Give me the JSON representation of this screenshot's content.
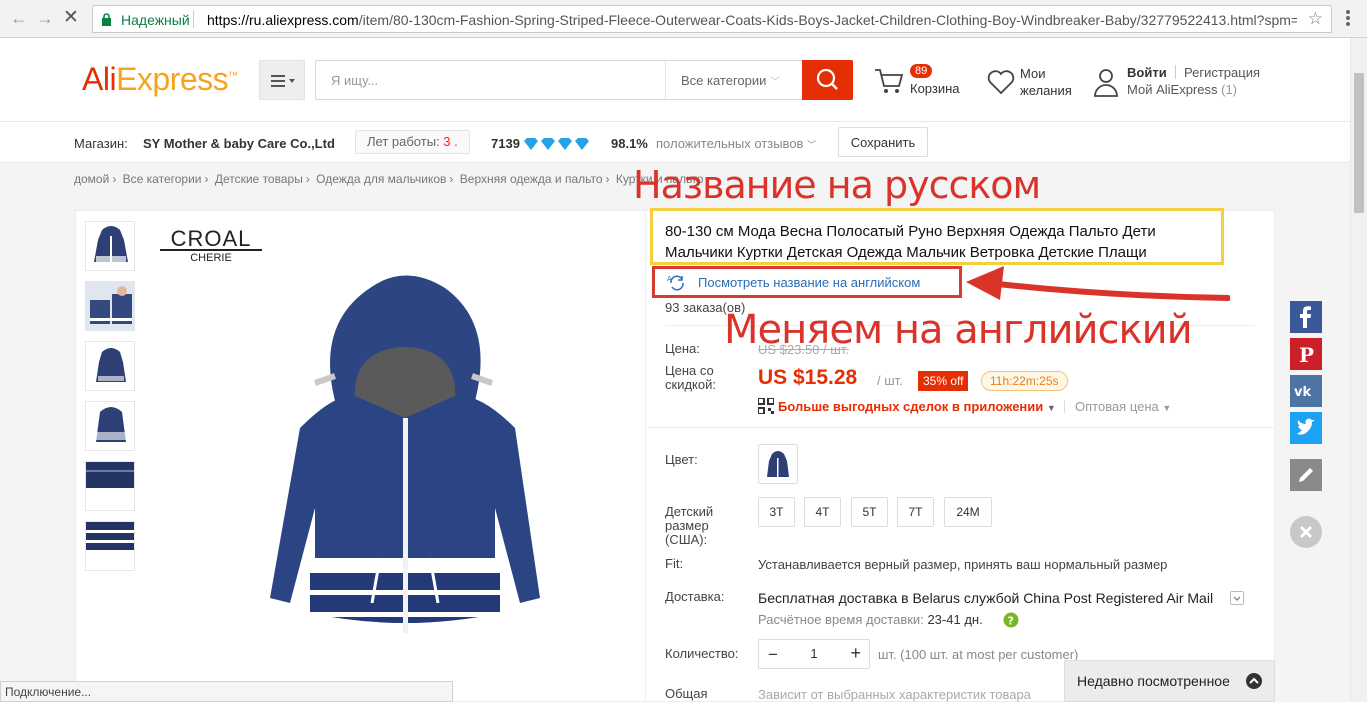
{
  "browser": {
    "secure_label": "Надежный",
    "url_host": "https://ru.aliexpress.com",
    "url_path": "/item/80-130cm-Fashion-Spring-Striped-Fleece-Outerwear-Coats-Kids-Boys-Jacket-Children-Clothing-Boy-Windbreaker-Baby/32779522413.html?spm=2",
    "status_text": "Подключение..."
  },
  "header": {
    "logo_ali": "Ali",
    "logo_express": "Express",
    "logo_tm": "™",
    "search_placeholder": "Я ищу...",
    "search_category": "Все категории",
    "cart_count": "89",
    "cart_label": "Корзина",
    "wishlist_line1": "Мои",
    "wishlist_line2": "желания",
    "login": "Войти",
    "register": "Регистрация",
    "my_ali": "Мой AliExpress",
    "my_ali_count": "(1)"
  },
  "store": {
    "label": "Магазин:",
    "name": "SY Mother & baby Care Co.,Ltd",
    "years_label": "Лет работы:",
    "years_value": "3 .",
    "score": "7139",
    "positive_pct": "98.1%",
    "positive_label": "положительных отзывов",
    "save_label": "Сохранить"
  },
  "breadcrumb": [
    "домой",
    "Все категории",
    "Детские товары",
    "Одежда для мальчиков",
    "Верхняя одежда и пальто",
    "Куртки и пальто"
  ],
  "product": {
    "brand_line1": "CROAL",
    "brand_line2": "CHERIE",
    "title": "80-130 см Мода Весна Полосатый Руно Верхняя Одежда Пальто Дети Мальчики Куртки Детская Одежда Мальчик Ветровка Детские Плащи",
    "view_english": "Посмотреть название на английском",
    "orders": "93 заказа(ов)",
    "price_label": "Цена:",
    "old_price": "US $23.50 / шт.",
    "discount_price_label_1": "Цена со",
    "discount_price_label_2": "скидкой:",
    "price": "US $15.28",
    "unit": "/ шт.",
    "discount": "35% off",
    "timer": "11h:22m:25s",
    "app_deal": "Больше выгодных сделок в приложении",
    "wholesale": "Оптовая цена",
    "color_label": "Цвет:",
    "size_label_1": "Детский",
    "size_label_2": "размер",
    "size_label_3": "(США):",
    "sizes": [
      "3T",
      "4T",
      "5T",
      "7T",
      "24M"
    ],
    "fit_label": "Fit:",
    "fit_text": "Устанавливается верный размер, принять ваш нормальный размер",
    "delivery_label": "Доставка:",
    "delivery_text": "Бесплатная доставка в Belarus службой China Post Registered Air Mail",
    "delivery_time_label": "Расчётное время доставки:",
    "delivery_time": "23-41",
    "delivery_days": "дн.",
    "qty_label": "Количество:",
    "qty_minus": "−",
    "qty_value": "1",
    "qty_plus": "+",
    "qty_info": "шт. (100 шт. at most per customer)",
    "total_label": "Общая",
    "total_text": "Зависит от выбранных характеристик товара"
  },
  "recently_viewed": "Недавно посмотренное",
  "annotations": {
    "russian_name": "Название на русском",
    "change_to_english": "Меняем на английский"
  },
  "colors": {
    "brand_red": "#e62e04",
    "brand_orange": "#f7a41d",
    "annotation_red": "#d9332a",
    "highlight_yellow": "#f3d03e",
    "link_blue": "#2a6db3"
  },
  "social_icons": [
    "facebook-icon",
    "pinterest-icon",
    "vk-icon",
    "twitter-icon",
    "pencil-icon",
    "close-icon"
  ]
}
